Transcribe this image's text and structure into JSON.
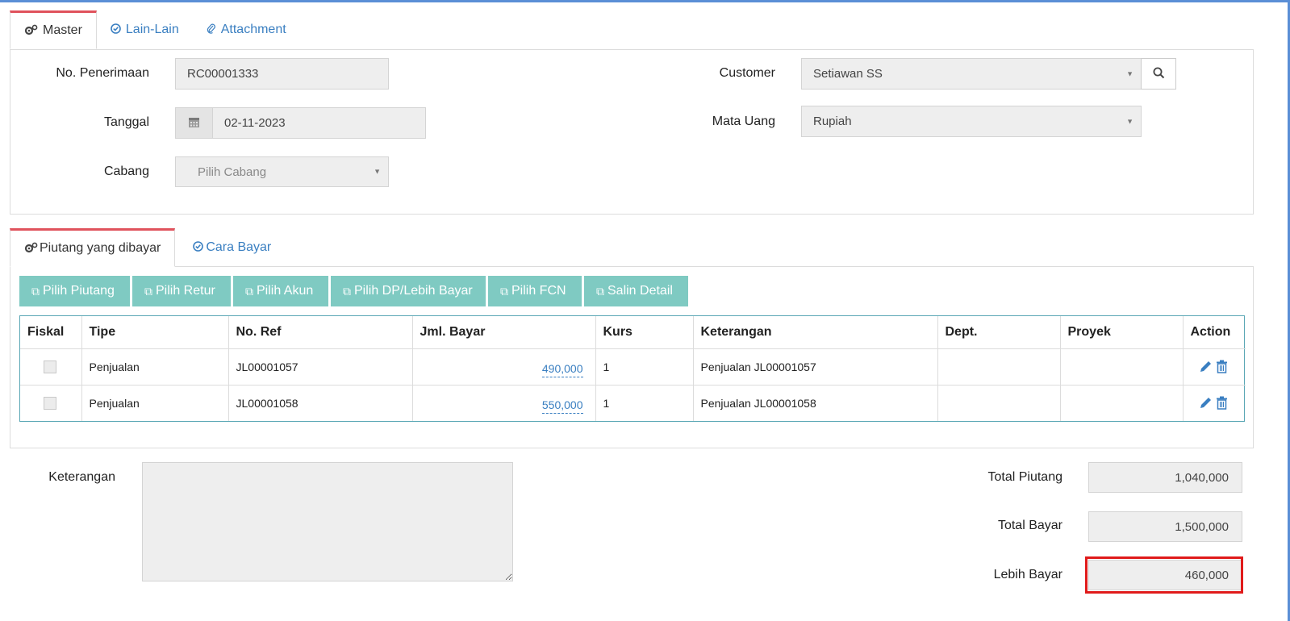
{
  "top_tabs": [
    {
      "label": "Master",
      "icon": "gears-icon"
    },
    {
      "label": "Lain-Lain",
      "icon": "check-circle-icon"
    },
    {
      "label": "Attachment",
      "icon": "paperclip-icon"
    }
  ],
  "master": {
    "no_penerimaan": {
      "label": "No. Penerimaan",
      "value": "RC00001333"
    },
    "tanggal": {
      "label": "Tanggal",
      "value": "02-11-2023"
    },
    "cabang": {
      "label": "Cabang",
      "placeholder": "Pilih Cabang"
    },
    "customer": {
      "label": "Customer",
      "value": "Setiawan SS"
    },
    "mata_uang": {
      "label": "Mata Uang",
      "value": "Rupiah"
    }
  },
  "detail_tabs": [
    {
      "label": "Piutang yang dibayar",
      "icon": "gears-icon"
    },
    {
      "label": "Cara Bayar",
      "icon": "check-circle-icon"
    }
  ],
  "buttons": [
    {
      "label": "Pilih Piutang"
    },
    {
      "label": "Pilih Retur"
    },
    {
      "label": "Pilih Akun"
    },
    {
      "label": "Pilih DP/Lebih Bayar"
    },
    {
      "label": "Pilih FCN"
    },
    {
      "label": "Salin Detail"
    }
  ],
  "table": {
    "columns": [
      "Fiskal",
      "Tipe",
      "No. Ref",
      "Jml. Bayar",
      "Kurs",
      "Keterangan",
      "Dept.",
      "Proyek",
      "Action"
    ],
    "rows": [
      {
        "fiskal": false,
        "tipe": "Penjualan",
        "no_ref": "JL00001057",
        "jml_bayar": "490,000",
        "kurs": "1",
        "keterangan": "Penjualan JL00001057",
        "dept": "",
        "proyek": ""
      },
      {
        "fiskal": false,
        "tipe": "Penjualan",
        "no_ref": "JL00001058",
        "jml_bayar": "550,000",
        "kurs": "1",
        "keterangan": "Penjualan JL00001058",
        "dept": "",
        "proyek": ""
      }
    ]
  },
  "footer": {
    "keterangan_label": "Keterangan",
    "keterangan_value": "",
    "total_piutang": {
      "label": "Total Piutang",
      "value": "1,040,000"
    },
    "total_bayar": {
      "label": "Total Bayar",
      "value": "1,500,000"
    },
    "lebih_bayar": {
      "label": "Lebih Bayar",
      "value": "460,000"
    }
  },
  "colors": {
    "accent": "#3a7fc1",
    "tab_active": "#e0525c",
    "button": "#7fcac2",
    "highlight": "#e01b1b"
  }
}
